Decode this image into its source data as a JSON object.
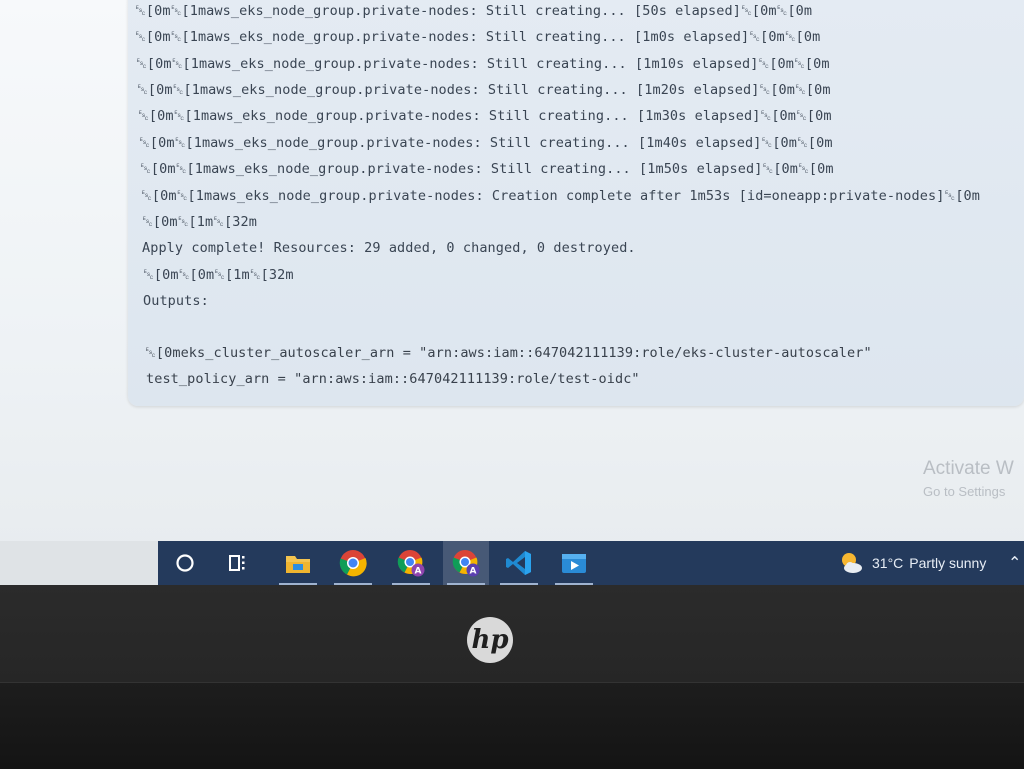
{
  "terminal": {
    "lines": [
      "␛[0m␛[1maws_eks_node_group.private-nodes: Still creating... [50s elapsed]␛[0m␛[0m",
      "␛[0m␛[1maws_eks_node_group.private-nodes: Still creating... [1m0s elapsed]␛[0m␛[0m",
      "␛[0m␛[1maws_eks_node_group.private-nodes: Still creating... [1m10s elapsed]␛[0m␛[0m",
      "␛[0m␛[1maws_eks_node_group.private-nodes: Still creating... [1m20s elapsed]␛[0m␛[0m",
      "␛[0m␛[1maws_eks_node_group.private-nodes: Still creating... [1m30s elapsed]␛[0m␛[0m",
      "␛[0m␛[1maws_eks_node_group.private-nodes: Still creating... [1m40s elapsed]␛[0m␛[0m",
      "␛[0m␛[1maws_eks_node_group.private-nodes: Still creating... [1m50s elapsed]␛[0m␛[0m",
      "␛[0m␛[1maws_eks_node_group.private-nodes: Creation complete after 1m53s [id=oneapp:private-nodes]␛[0m",
      "␛[0m␛[1m␛[32m",
      "Apply complete! Resources: 29 added, 0 changed, 0 destroyed.",
      "␛[0m␛[0m␛[1m␛[32m",
      "Outputs:",
      "␛[0meks_cluster_autoscaler_arn = \"arn:aws:iam::647042111139:role/eks-cluster-autoscaler\"",
      "test_policy_arn = \"arn:aws:iam::647042111139:role/test-oidc\""
    ]
  },
  "watermark": {
    "line1": "Activate W",
    "line2": "Go to Settings"
  },
  "taskbar": {
    "icons": [
      {
        "name": "cortana-icon"
      },
      {
        "name": "task-view-icon"
      },
      {
        "name": "file-explorer-icon"
      },
      {
        "name": "chrome-icon"
      },
      {
        "name": "chrome-profile-a-icon"
      },
      {
        "name": "chrome-profile-a-active-icon"
      },
      {
        "name": "vscode-icon"
      },
      {
        "name": "media-player-icon"
      }
    ],
    "weather": {
      "temp": "31°C",
      "desc": "Partly sunny"
    }
  },
  "bezel": {
    "brand": "hp"
  },
  "colors": {
    "taskbar": "#243a5c",
    "terminal_bg": "#e4ebf3",
    "terminal_text": "#3a4553"
  }
}
